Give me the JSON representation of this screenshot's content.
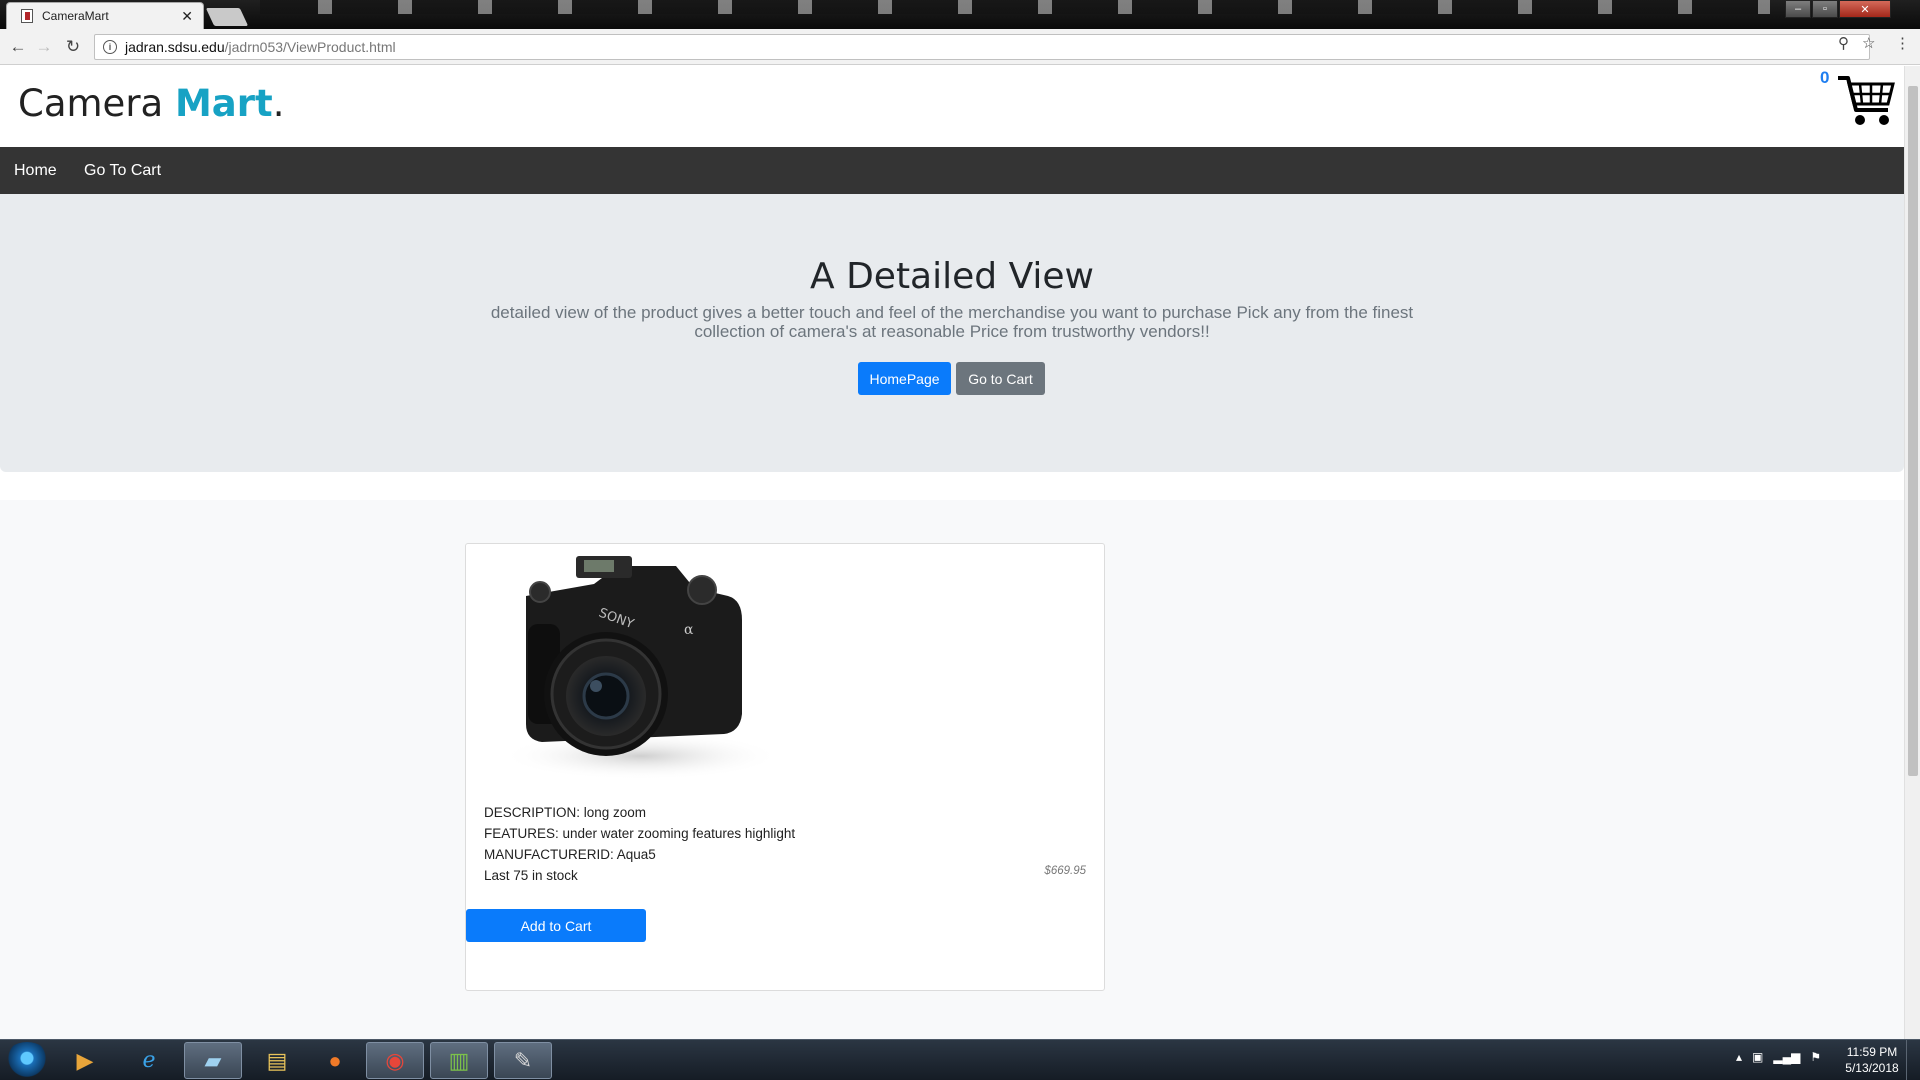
{
  "browser": {
    "tab_title": "CameraMart",
    "tab_close": "✕",
    "url_host": "jadran.sdsu.edu",
    "url_path": "/jadrn053/ViewProduct.html"
  },
  "site": {
    "brand_main": "Camera",
    "brand_accent": "Mart",
    "brand_dot": ".",
    "cart_count": "0"
  },
  "nav": {
    "home": "Home",
    "go_to_cart": "Go To Cart"
  },
  "hero": {
    "title": "A Detailed View",
    "description": "detailed view of the product gives a better touch and feel of the merchandise you want to purchase Pick any from the finest collection of camera's at reasonable Price from trustworthy vendors!!",
    "btn_homepage": "HomePage",
    "btn_cart": "Go to Cart"
  },
  "product": {
    "description": "DESCRIPTION: long zoom",
    "features": "FEATURES: under water zooming features highlight",
    "manufacturer": "MANUFACTURERID: Aqua5",
    "stock": "Last 75 in stock",
    "price": "$669.95",
    "add_to_cart": "Add to Cart",
    "camera_brand": "SONY",
    "camera_model": "α"
  },
  "taskbar": {
    "time": "11:59 PM",
    "date": "5/13/2018"
  },
  "colors": {
    "accent": "#17a2c4",
    "primary_button": "#0a7bfb",
    "secondary_button": "#6c757d",
    "navbar": "#343434",
    "jumbotron": "#e8ebee"
  }
}
